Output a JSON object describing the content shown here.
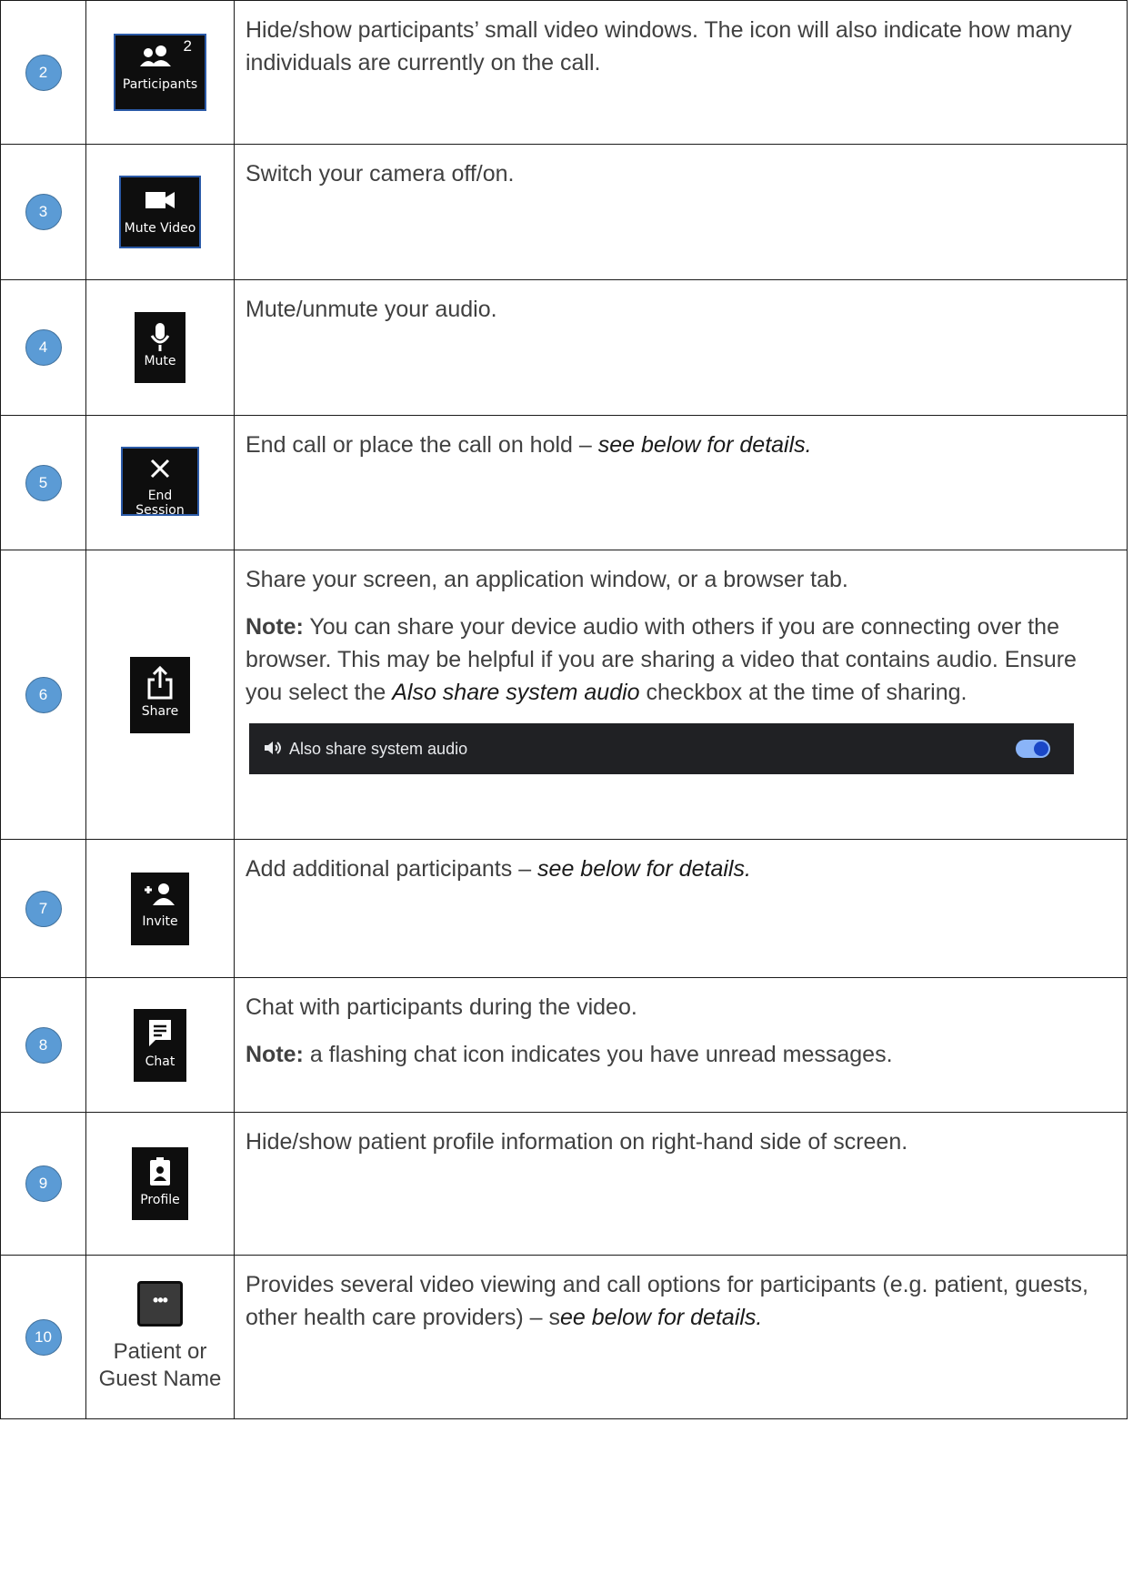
{
  "rows": [
    {
      "number": "2",
      "icon": {
        "name": "participants-icon",
        "label": "Participants",
        "badge": "2"
      },
      "paragraphs": [
        {
          "text": "Hide/show participants’ small video windows. The icon will also indicate how many individuals are currently on the call."
        }
      ]
    },
    {
      "number": "3",
      "icon": {
        "name": "video-camera-icon",
        "label": "Mute Video"
      },
      "paragraphs": [
        {
          "text": "Switch your camera off/on."
        }
      ]
    },
    {
      "number": "4",
      "icon": {
        "name": "microphone-icon",
        "label": "Mute"
      },
      "paragraphs": [
        {
          "text": "Mute/unmute your audio."
        }
      ]
    },
    {
      "number": "5",
      "icon": {
        "name": "close-icon",
        "label": "End Session"
      },
      "paragraphs": [
        {
          "text": "End call or place the call on hold – ",
          "italic_suffix": "see below for details."
        }
      ]
    },
    {
      "number": "6",
      "icon": {
        "name": "share-icon",
        "label": "Share"
      },
      "paragraphs": [
        {
          "text": "Share your screen, an application window, or a browser tab."
        },
        {
          "bold_prefix": "Note:",
          "text_before": " You can share your device audio with others if you are connecting over the browser. This may be helpful if you are sharing a video that contains audio. Ensure you select the ",
          "italic_mid": "Also share system audio",
          "text_after": " checkbox at the time of sharing."
        }
      ],
      "audio_bar": {
        "label": "Also share system audio",
        "toggle_on": true
      }
    },
    {
      "number": "7",
      "icon": {
        "name": "add-person-icon",
        "label": "Invite"
      },
      "paragraphs": [
        {
          "text": "Add additional participants – ",
          "italic_suffix": "see below for details."
        }
      ]
    },
    {
      "number": "8",
      "icon": {
        "name": "chat-icon",
        "label": "Chat"
      },
      "paragraphs": [
        {
          "text": "Chat with participants during the video."
        },
        {
          "bold_prefix": "Note:",
          "text": " a flashing chat icon indicates you have unread messages."
        }
      ]
    },
    {
      "number": "9",
      "icon": {
        "name": "profile-badge-icon",
        "label": "Profile"
      },
      "paragraphs": [
        {
          "text": "Hide/show patient profile information on right-hand side of screen."
        }
      ]
    },
    {
      "number": "10",
      "icon": {
        "name": "more-options-icon",
        "label": "Patient or Guest Name",
        "glyph": "•••"
      },
      "paragraphs": [
        {
          "text": "Provides several video viewing and call options for participants (e.g. patient, guests, other health care providers) – s",
          "italic_suffix": "ee below for details."
        }
      ]
    }
  ],
  "colors": {
    "number_circle": "#5b9bd5",
    "button_bg": "#0e0e0e",
    "button_border": "#2b5aa7",
    "audio_bar_bg": "#202124",
    "toggle_track": "#8ab4f8",
    "toggle_knob": "#1a47c6"
  }
}
